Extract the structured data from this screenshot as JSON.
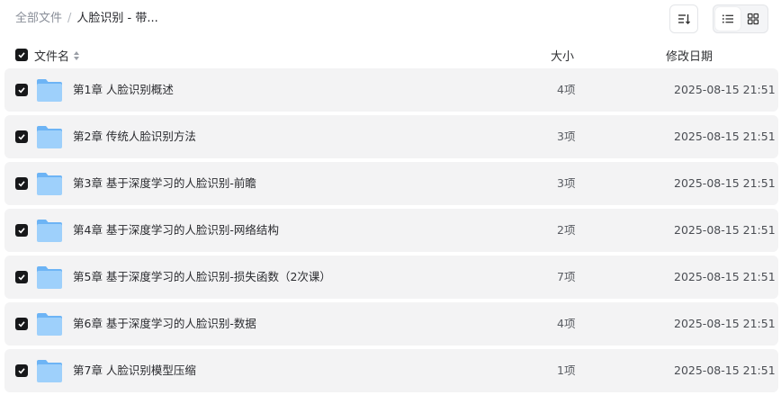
{
  "breadcrumb": {
    "root": "全部文件",
    "separator": "/",
    "current": "人脸识别 - 带..."
  },
  "toolbar": {
    "sort_icon": "sort-lines-icon",
    "list_view_icon": "list-view-icon",
    "grid_view_icon": "grid-view-icon",
    "active_view": "list"
  },
  "columns": {
    "name": "文件名",
    "size": "大小",
    "date": "修改日期"
  },
  "rows": [
    {
      "name": "第1章 人脸识别概述",
      "size": "4项",
      "date": "2025-08-15 21:51",
      "checked": true
    },
    {
      "name": "第2章 传统人脸识别方法",
      "size": "3项",
      "date": "2025-08-15 21:51",
      "checked": true
    },
    {
      "name": "第3章 基于深度学习的人脸识别-前瞻",
      "size": "3项",
      "date": "2025-08-15 21:51",
      "checked": true
    },
    {
      "name": "第4章 基于深度学习的人脸识别-网络结构",
      "size": "2项",
      "date": "2025-08-15 21:51",
      "checked": true
    },
    {
      "name": "第5章 基于深度学习的人脸识别-损失函数（2次课）",
      "size": "7项",
      "date": "2025-08-15 21:51",
      "checked": true
    },
    {
      "name": "第6章 基于深度学习的人脸识别-数据",
      "size": "4项",
      "date": "2025-08-15 21:51",
      "checked": true
    },
    {
      "name": "第7章 人脸识别模型压缩",
      "size": "1项",
      "date": "2025-08-15 21:51",
      "checked": true
    }
  ],
  "colors": {
    "row_bg": "#f3f3f4",
    "checkbox": "#17181a",
    "folder_light": "#9ed0fb",
    "folder_dark": "#6db4f5"
  }
}
